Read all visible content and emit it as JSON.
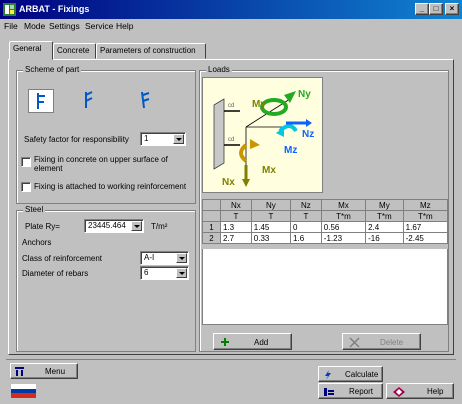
{
  "app": {
    "title": "ARBAT - Fixings"
  },
  "window_controls": {
    "minimize": "_",
    "maximize": "□",
    "close": "×"
  },
  "menu": [
    "File",
    "Mode",
    "Settings",
    "Service",
    "Help"
  ],
  "tabs": [
    "General",
    "Concrete",
    "Parameters of construction"
  ],
  "scheme": {
    "title": "Scheme of part",
    "safety_factor_label": "Safety factor for responsibility",
    "safety_factor_value": "1",
    "fixing_upper_label": "Fixing in concrete on upper surface of element",
    "fixing_reinforcement_label": "Fixing is attached to working reinforcement"
  },
  "steel": {
    "title": "Steel",
    "plate_label": "Plate Ry=",
    "plate_value": "23445.464",
    "plate_unit": "T/m²",
    "anchors_label": "Anchors",
    "class_label": "Class of reinforcement",
    "class_value": "A-I",
    "diameter_label": "Diameter of rebars",
    "diameter_value": "6"
  },
  "loads": {
    "title": "Loads",
    "diagram_labels": {
      "my": "My",
      "ny": "Ny",
      "nz": "Nz",
      "mz": "Mz",
      "nx": "Nx",
      "mx": "Mx"
    },
    "columns": [
      "Nx",
      "Ny",
      "Nz",
      "Mx",
      "My",
      "Mz"
    ],
    "units": [
      "T",
      "T",
      "T",
      "T*m",
      "T*m",
      "T*m"
    ],
    "rows": [
      {
        "n": "1",
        "values": [
          "1.3",
          "1.45",
          "0",
          "0.56",
          "2.4",
          "1.67"
        ]
      },
      {
        "n": "2",
        "values": [
          "2.7",
          "0.33",
          "1.6",
          "-1.23",
          "-16",
          "-2.45"
        ]
      }
    ],
    "add_label": "Add",
    "delete_label": "Delete"
  },
  "bottom": {
    "menu_label": "Menu",
    "calculate_label": "Calculate",
    "report_label": "Report",
    "help_label": "Help"
  }
}
